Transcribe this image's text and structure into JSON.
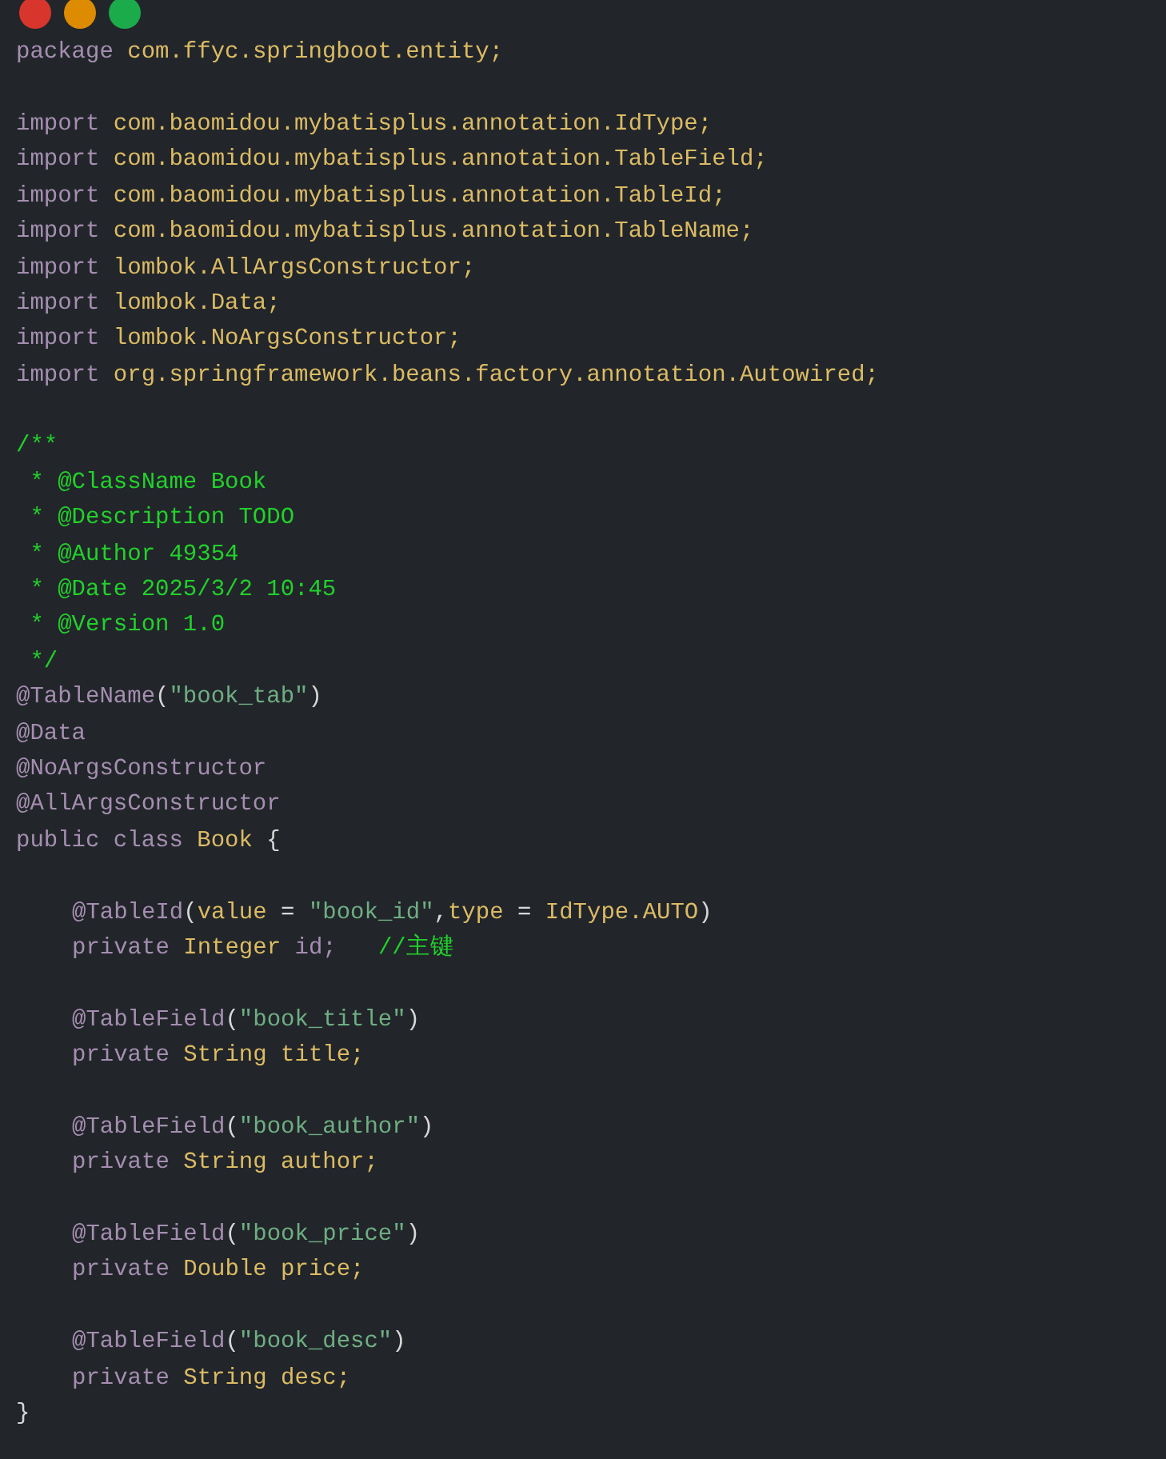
{
  "window_controls": [
    {
      "color": "#d8362c"
    },
    {
      "color": "#dd8b00"
    },
    {
      "color": "#1bab4b"
    }
  ],
  "code_blocks": [
    {
      "lines": [
        {
          "tokens": [
            {
              "kind": "kw",
              "text": "package "
            },
            {
              "kind": "ident",
              "text": "com.ffyc.springboot.entity;"
            }
          ]
        }
      ]
    },
    {
      "lines": [
        {
          "tokens": [
            {
              "kind": "kw",
              "text": "import "
            },
            {
              "kind": "ident",
              "text": "com.baomidou.mybatisplus.annotation.IdType;"
            }
          ]
        },
        {
          "tokens": [
            {
              "kind": "kw",
              "text": "import "
            },
            {
              "kind": "ident",
              "text": "com.baomidou.mybatisplus.annotation.TableField;"
            }
          ]
        },
        {
          "tokens": [
            {
              "kind": "kw",
              "text": "import "
            },
            {
              "kind": "ident",
              "text": "com.baomidou.mybatisplus.annotation.TableId;"
            }
          ]
        },
        {
          "tokens": [
            {
              "kind": "kw",
              "text": "import "
            },
            {
              "kind": "ident",
              "text": "com.baomidou.mybatisplus.annotation.TableName;"
            }
          ]
        },
        {
          "tokens": [
            {
              "kind": "kw",
              "text": "import "
            },
            {
              "kind": "ident",
              "text": "lombok.AllArgsConstructor;"
            }
          ]
        },
        {
          "tokens": [
            {
              "kind": "kw",
              "text": "import "
            },
            {
              "kind": "ident",
              "text": "lombok.Data;"
            }
          ]
        },
        {
          "tokens": [
            {
              "kind": "kw",
              "text": "import "
            },
            {
              "kind": "ident",
              "text": "lombok.NoArgsConstructor;"
            }
          ]
        },
        {
          "tokens": [
            {
              "kind": "kw",
              "text": "import "
            },
            {
              "kind": "ident",
              "text": "org.springframework.beans.factory.annotation.Autowired;"
            }
          ]
        }
      ]
    },
    {
      "lines": [
        {
          "tokens": [
            {
              "kind": "comment",
              "text": "/**"
            }
          ]
        },
        {
          "tokens": [
            {
              "kind": "comment",
              "text": " * @ClassName Book"
            }
          ]
        },
        {
          "tokens": [
            {
              "kind": "comment",
              "text": " * @Description TODO"
            }
          ]
        },
        {
          "tokens": [
            {
              "kind": "comment",
              "text": " * @Author 49354"
            }
          ]
        },
        {
          "tokens": [
            {
              "kind": "comment",
              "text": " * @Date 2025/3/2 10:45"
            }
          ]
        },
        {
          "tokens": [
            {
              "kind": "comment",
              "text": " * @Version 1.0"
            }
          ]
        },
        {
          "tokens": [
            {
              "kind": "comment",
              "text": " */"
            }
          ]
        },
        {
          "tokens": [
            {
              "kind": "kw",
              "text": "@TableName"
            },
            {
              "kind": "punct",
              "text": "("
            },
            {
              "kind": "str",
              "text": "\"book_tab\""
            },
            {
              "kind": "punct",
              "text": ")"
            }
          ]
        },
        {
          "tokens": [
            {
              "kind": "kw",
              "text": "@Data"
            }
          ]
        },
        {
          "tokens": [
            {
              "kind": "kw",
              "text": "@NoArgsConstructor"
            }
          ]
        },
        {
          "tokens": [
            {
              "kind": "kw",
              "text": "@AllArgsConstructor"
            }
          ]
        },
        {
          "tokens": [
            {
              "kind": "kw",
              "text": "public class "
            },
            {
              "kind": "ident",
              "text": "Book "
            },
            {
              "kind": "punct",
              "text": "{"
            }
          ],
          "children": [
            {
              "lines": [
                {
                  "tokens": [
                    {
                      "kind": "kw",
                      "text": "@TableId"
                    },
                    {
                      "kind": "punct",
                      "text": "("
                    },
                    {
                      "kind": "ident",
                      "text": "value "
                    },
                    {
                      "kind": "punct",
                      "text": "= "
                    },
                    {
                      "kind": "str",
                      "text": "\"book_id\""
                    },
                    {
                      "kind": "punct",
                      "text": ","
                    },
                    {
                      "kind": "ident",
                      "text": "type "
                    },
                    {
                      "kind": "punct",
                      "text": "= "
                    },
                    {
                      "kind": "ident",
                      "text": "IdType.AUTO"
                    },
                    {
                      "kind": "punct",
                      "text": ")"
                    }
                  ]
                },
                {
                  "tokens": [
                    {
                      "kind": "kw",
                      "text": "private "
                    },
                    {
                      "kind": "ident",
                      "text": "Integer "
                    },
                    {
                      "kind": "kw",
                      "text": "id;   "
                    },
                    {
                      "kind": "comment",
                      "text": "//主键"
                    }
                  ]
                }
              ]
            },
            {
              "lines": [
                {
                  "tokens": [
                    {
                      "kind": "kw",
                      "text": "@TableField"
                    },
                    {
                      "kind": "punct",
                      "text": "("
                    },
                    {
                      "kind": "str",
                      "text": "\"book_title\""
                    },
                    {
                      "kind": "punct",
                      "text": ")"
                    }
                  ]
                },
                {
                  "tokens": [
                    {
                      "kind": "kw",
                      "text": "private "
                    },
                    {
                      "kind": "ident",
                      "text": "String title;"
                    }
                  ]
                }
              ]
            },
            {
              "lines": [
                {
                  "tokens": [
                    {
                      "kind": "kw",
                      "text": "@TableField"
                    },
                    {
                      "kind": "punct",
                      "text": "("
                    },
                    {
                      "kind": "str",
                      "text": "\"book_author\""
                    },
                    {
                      "kind": "punct",
                      "text": ")"
                    }
                  ]
                },
                {
                  "tokens": [
                    {
                      "kind": "kw",
                      "text": "private "
                    },
                    {
                      "kind": "ident",
                      "text": "String author;"
                    }
                  ]
                }
              ]
            },
            {
              "lines": [
                {
                  "tokens": [
                    {
                      "kind": "kw",
                      "text": "@TableField"
                    },
                    {
                      "kind": "punct",
                      "text": "("
                    },
                    {
                      "kind": "str",
                      "text": "\"book_price\""
                    },
                    {
                      "kind": "punct",
                      "text": ")"
                    }
                  ]
                },
                {
                  "tokens": [
                    {
                      "kind": "kw",
                      "text": "private "
                    },
                    {
                      "kind": "ident",
                      "text": "Double price;"
                    }
                  ]
                }
              ]
            },
            {
              "lines": [
                {
                  "tokens": [
                    {
                      "kind": "kw",
                      "text": "@TableField"
                    },
                    {
                      "kind": "punct",
                      "text": "("
                    },
                    {
                      "kind": "str",
                      "text": "\"book_desc\""
                    },
                    {
                      "kind": "punct",
                      "text": ")"
                    }
                  ]
                },
                {
                  "tokens": [
                    {
                      "kind": "kw",
                      "text": "private "
                    },
                    {
                      "kind": "ident",
                      "text": "String desc;"
                    }
                  ]
                }
              ]
            }
          ]
        },
        {
          "tokens": [
            {
              "kind": "punct",
              "text": "}"
            }
          ]
        }
      ]
    }
  ]
}
